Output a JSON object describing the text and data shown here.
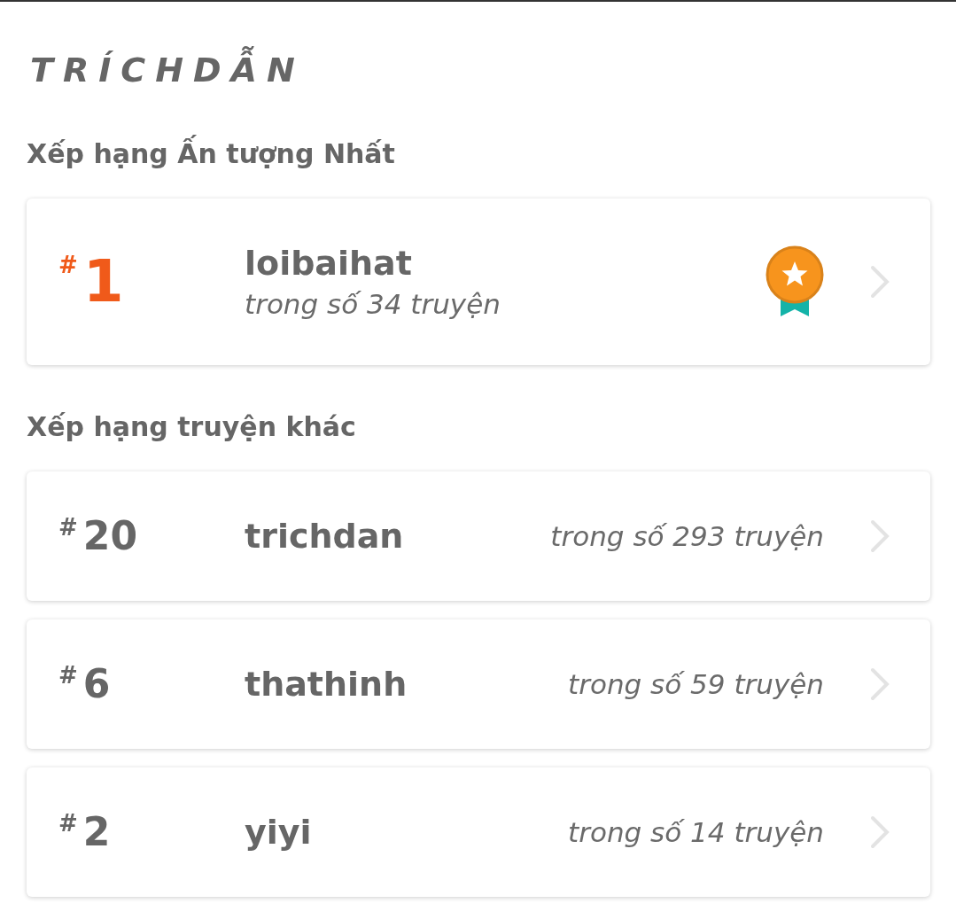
{
  "title": "TRÍCHDẪN",
  "sections": [
    {
      "heading": "Xếp hạng Ấn tượng Nhất",
      "cards": [
        {
          "kind": "featured",
          "hash": "#",
          "rank": "1",
          "name": "loibaihat",
          "count": "trong số 34 truyện",
          "badge": true
        }
      ]
    },
    {
      "heading": "Xếp hạng truyện khác",
      "cards": [
        {
          "kind": "compact",
          "hash": "#",
          "rank": "20",
          "name": "trichdan",
          "count": "trong số 293 truyện"
        },
        {
          "kind": "compact",
          "hash": "#",
          "rank": "6",
          "name": "thathinh",
          "count": "trong số 59 truyện"
        },
        {
          "kind": "compact",
          "hash": "#",
          "rank": "2",
          "name": "yiyi",
          "count": "trong số 14 truyện"
        }
      ]
    }
  ]
}
